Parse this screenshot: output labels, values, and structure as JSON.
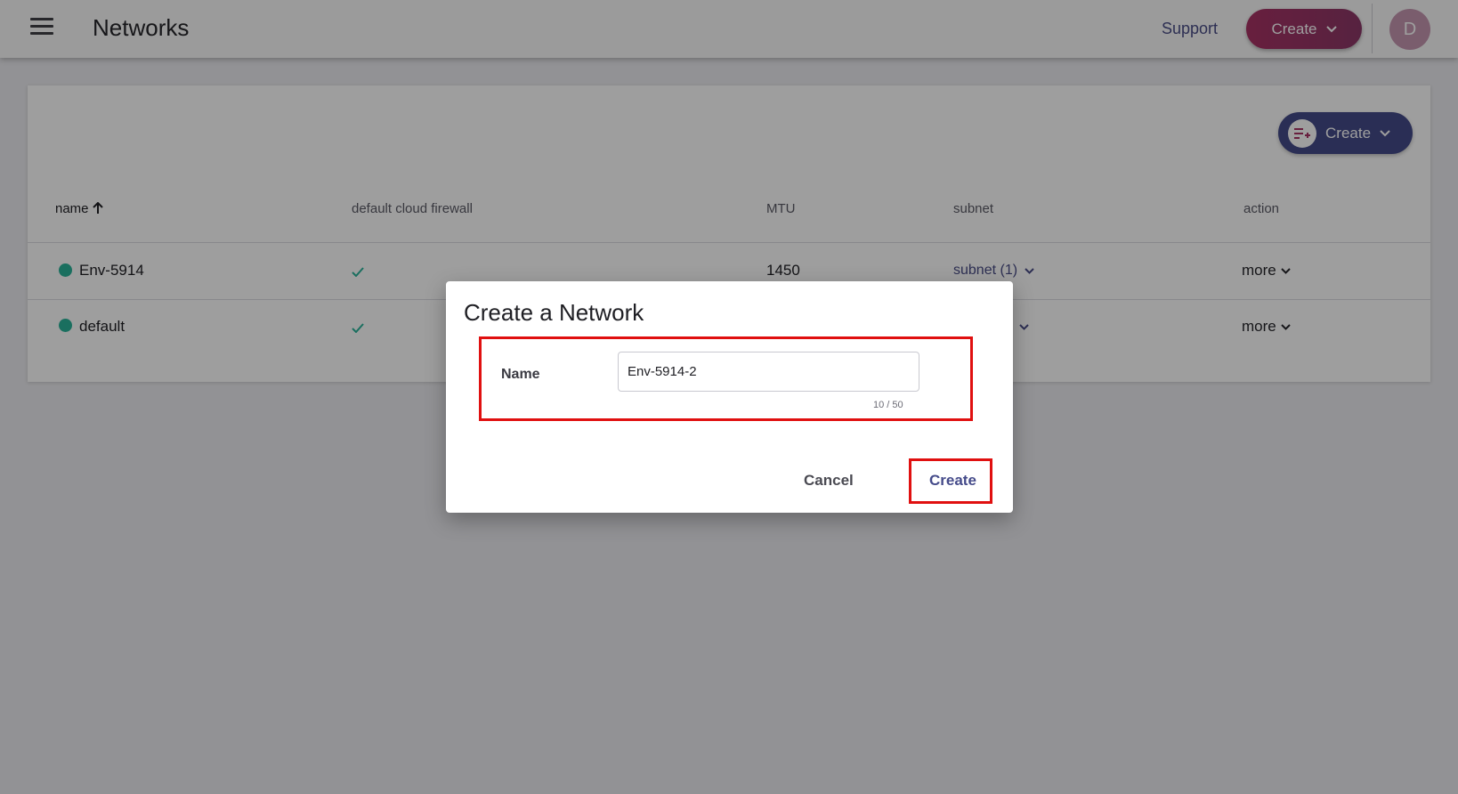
{
  "header": {
    "title": "Networks",
    "support_label": "Support",
    "create_label": "Create",
    "avatar_initial": "D"
  },
  "toolbar": {
    "create_label": "Create"
  },
  "table": {
    "columns": [
      "name",
      "default cloud firewall",
      "MTU",
      "subnet",
      "action"
    ],
    "rows": [
      {
        "name": "Env-5914",
        "mtu": "1450",
        "subnet": "subnet (1)",
        "action": "more"
      },
      {
        "name": "default",
        "mtu": "",
        "subnet": ")",
        "action": "more"
      }
    ]
  },
  "dialog": {
    "title": "Create a Network",
    "name_label": "Name",
    "name_value": "Env-5914-2",
    "char_count": "10 / 50",
    "cancel_label": "Cancel",
    "create_label": "Create"
  },
  "colors": {
    "accent": "#454b8a",
    "brand": "#a83265",
    "status_ok": "#2bb39a",
    "highlight": "#e01010"
  }
}
